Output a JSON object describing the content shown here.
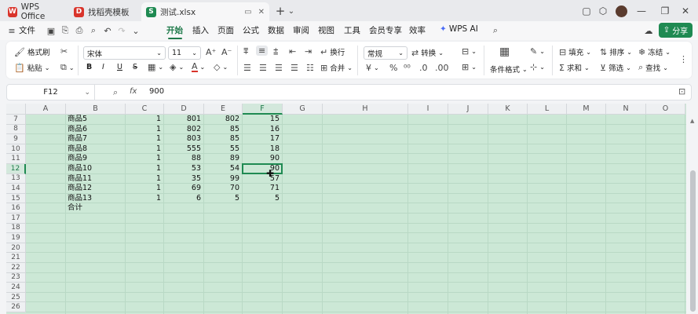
{
  "tabs": [
    {
      "label": "WPS Office",
      "icon": "wps-logo-icon",
      "color": "#d9342b"
    },
    {
      "label": "找稻壳模板",
      "icon": "docer-icon",
      "color": "#d9342b"
    },
    {
      "label": "测试.xlsx",
      "icon": "sheet-file-icon",
      "color": "#1f8a52"
    }
  ],
  "titlebar": {
    "new_tab": "+",
    "dropdown": "⌄"
  },
  "menu": {
    "file": "文件",
    "items": [
      "开始",
      "插入",
      "页面",
      "公式",
      "数据",
      "审阅",
      "视图",
      "工具",
      "会员专享",
      "效率"
    ],
    "active": "开始",
    "wps_ai": "WPS AI",
    "share": "分享"
  },
  "ribbon": {
    "format_painter": "格式刷",
    "paste": "粘贴",
    "font_name": "宋体",
    "font_size": "11",
    "wrap": "换行",
    "merge": "合并",
    "number_format": "常规",
    "convert": "转换",
    "cond_format": "条件格式",
    "fill": "填充",
    "sort": "排序",
    "freeze": "冻结",
    "sum": "求和",
    "filter": "筛选",
    "find": "查找",
    "bold": "B",
    "italic": "I",
    "underline": "U",
    "strike": "S",
    "font_color": "A",
    "yuan": "¥",
    "percent": "%"
  },
  "formula": {
    "cell_ref": "F12",
    "fx": "fx",
    "value": "900"
  },
  "sheet": {
    "columns": [
      "A",
      "B",
      "C",
      "D",
      "E",
      "F",
      "G",
      "H",
      "I",
      "J",
      "K",
      "L",
      "M",
      "N",
      "O"
    ],
    "selected_column": "F",
    "selected_row": "12",
    "rows": [
      {
        "n": "7",
        "B": "商品5",
        "C": "1",
        "D": "801",
        "E": "802",
        "F": "15"
      },
      {
        "n": "8",
        "B": "商品6",
        "C": "1",
        "D": "802",
        "E": "85",
        "F": "16"
      },
      {
        "n": "9",
        "B": "商品7",
        "C": "1",
        "D": "803",
        "E": "85",
        "F": "17"
      },
      {
        "n": "10",
        "B": "商品8",
        "C": "1",
        "D": "555",
        "E": "55",
        "F": "18"
      },
      {
        "n": "11",
        "B": "商品9",
        "C": "1",
        "D": "88",
        "E": "89",
        "F": "90"
      },
      {
        "n": "12",
        "B": "商品10",
        "C": "1",
        "D": "53",
        "E": "54",
        "F": "90"
      },
      {
        "n": "13",
        "B": "商品11",
        "C": "1",
        "D": "35",
        "E": "99",
        "F": "57"
      },
      {
        "n": "14",
        "B": "商品12",
        "C": "1",
        "D": "69",
        "E": "70",
        "F": "71"
      },
      {
        "n": "15",
        "B": "商品13",
        "C": "1",
        "D": "6",
        "E": "5",
        "F": "5"
      },
      {
        "n": "16",
        "B": "合计",
        "C": "",
        "D": "",
        "E": "",
        "F": ""
      },
      {
        "n": "17",
        "B": "",
        "C": "",
        "D": "",
        "E": "",
        "F": ""
      },
      {
        "n": "18",
        "B": "",
        "C": "",
        "D": "",
        "E": "",
        "F": ""
      },
      {
        "n": "19",
        "B": "",
        "C": "",
        "D": "",
        "E": "",
        "F": ""
      },
      {
        "n": "20",
        "B": "",
        "C": "",
        "D": "",
        "E": "",
        "F": ""
      },
      {
        "n": "21",
        "B": "",
        "C": "",
        "D": "",
        "E": "",
        "F": ""
      },
      {
        "n": "22",
        "B": "",
        "C": "",
        "D": "",
        "E": "",
        "F": ""
      },
      {
        "n": "23",
        "B": "",
        "C": "",
        "D": "",
        "E": "",
        "F": ""
      },
      {
        "n": "24",
        "B": "",
        "C": "",
        "D": "",
        "E": "",
        "F": ""
      },
      {
        "n": "25",
        "B": "",
        "C": "",
        "D": "",
        "E": "",
        "F": ""
      },
      {
        "n": "26",
        "B": "",
        "C": "",
        "D": "",
        "E": "",
        "F": ""
      }
    ]
  },
  "colors": {
    "accent": "#1f8a52",
    "grid_bg": "#cce8d6"
  }
}
